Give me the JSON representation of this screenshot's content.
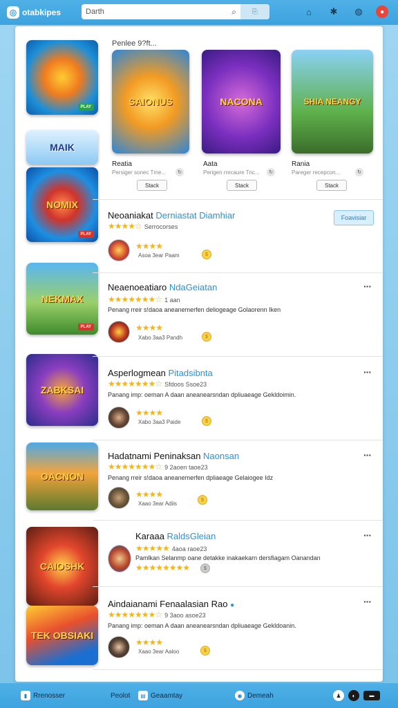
{
  "topbar": {
    "logo_text": "otabkipes",
    "search_value": "Darth",
    "search_button": "⎘",
    "icons": [
      "home-icon",
      "settings-icon",
      "help-icon",
      "notification-icon"
    ]
  },
  "featured": {
    "section_title": "Penlee 9?ft...",
    "cards": [
      {
        "art_title": "SAIONUS",
        "name": "Reatia",
        "sub": "Persiger sonec Tme...",
        "button": "Stack"
      },
      {
        "art_title": "NACONA",
        "name": "Aata",
        "sub": "Perigen rrecaure Tnc...",
        "button": "Stack"
      },
      {
        "art_title": "SHIA NEANGY",
        "name": "Rania",
        "sub": "Pareger recepcon...",
        "button": "Stack"
      }
    ]
  },
  "left_thumbs": [
    {
      "label": "",
      "badge": "PLAY"
    },
    {
      "label": "MAIK",
      "badge": ""
    },
    {
      "label": "NOMIX",
      "badge": "PLAY"
    },
    {
      "label": "NEKMAX",
      "badge": "PLAY"
    },
    {
      "label": "ZABKSAI",
      "badge": ""
    },
    {
      "label": "OACNON",
      "badge": ""
    },
    {
      "label": "CAIOSHK",
      "badge": ""
    },
    {
      "label": "TEK OBSIAKI",
      "badge": ""
    }
  ],
  "rows": [
    {
      "title": "Neoaniakat",
      "title_link": "Derniastat Diamhiar",
      "stars": "★★★★☆",
      "stars_text": "Serrocorses",
      "desc": "",
      "reviewer_stars": "★★★★",
      "reviewer_meta": "Asoa 3ear   Paam",
      "follow": "Foavisiar"
    },
    {
      "title": "Neaenoeatiaro",
      "title_link": "NdaGeiatan",
      "stars": "★★★★★★★☆",
      "stars_text": "1 aan",
      "desc": "Penang rreir s!daoa aneanemerfen deliogeage Golaorenn Iken",
      "reviewer_stars": "★★★★",
      "reviewer_meta": "Xabo 3aa3   Pandh"
    },
    {
      "title": "Asperlogmean",
      "title_link": "Pitadsibnta",
      "stars": "★★★★★★★☆",
      "stars_text": "Sfdoos Ssoe23",
      "desc": "Panang imp: oeman A daan aneanearsndan dpliuaeage Gekldoimin.",
      "reviewer_stars": "★★★★",
      "reviewer_meta": "Xabo 3aa3   Paide"
    },
    {
      "title": "Hadatnami Peninaksan",
      "title_link": "Naonsan",
      "stars": "★★★★★★★☆",
      "stars_text": "9 2aoen taoe23",
      "desc": "Penang rreir s!daoa aneanemerfen dpliaeage Gelaiogee Idz",
      "reviewer_stars": "★★★★",
      "reviewer_meta": "Xaao 3ear   Adiis"
    },
    {
      "title": "Karaaa",
      "title_link": "RaldsGleian",
      "stars": "★★★★★",
      "stars_text": "4aoa raoe23",
      "desc": "Pamlkan  Selanmp oane detakke inakaekarn dersfiagam Oanandan",
      "reviewer_stars": "★★★★★★★★",
      "reviewer_meta": ""
    },
    {
      "title": "Aindaianami Fenaalasian Rao",
      "title_link": "",
      "stars": "★★★★★★★☆",
      "stars_text": "9 3aoo asoe23",
      "desc": "Panang imp: oeman A daan aneanearsndan dpliuaeage Gekldoanin.",
      "reviewer_stars": "★★★★",
      "reviewer_meta": "Xaao 3ear   Aaloo"
    }
  ],
  "bottombar": {
    "left_label": "Rrenosser",
    "middle_label1": "Peolot",
    "middle_label2": "Geaamtay",
    "right_label": "Demeah"
  }
}
